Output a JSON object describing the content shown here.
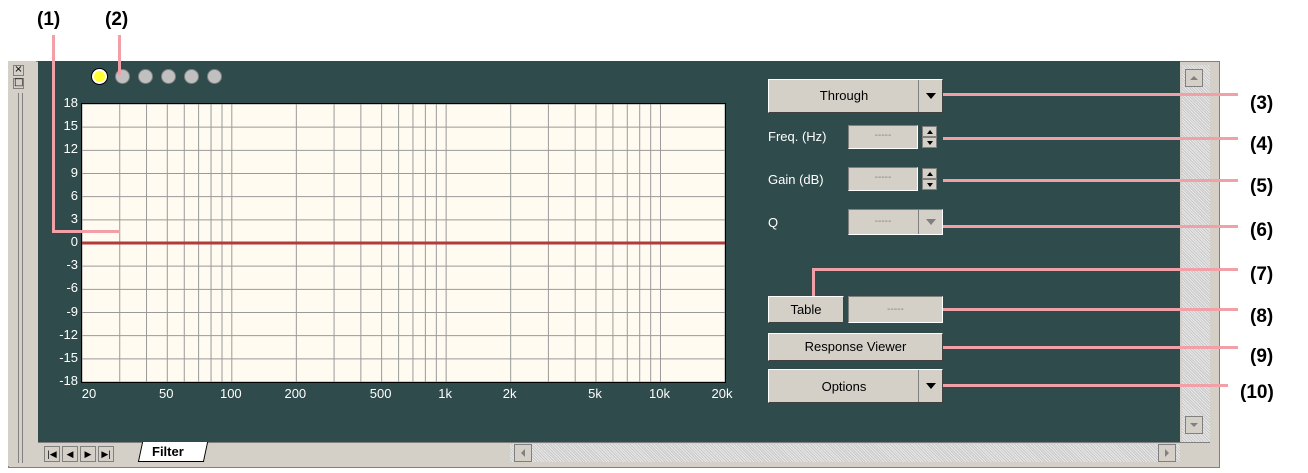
{
  "callouts": [
    "(1)",
    "(2)",
    "(3)",
    "(4)",
    "(5)",
    "(6)",
    "(7)",
    "(8)",
    "(9)",
    "(10)"
  ],
  "chart_data": {
    "type": "line",
    "x_ticks": [
      "20",
      "50",
      "100",
      "200",
      "500",
      "1k",
      "2k",
      "5k",
      "10k",
      "20k"
    ],
    "x_tick_values": [
      20,
      50,
      100,
      200,
      500,
      1000,
      2000,
      5000,
      10000,
      20000
    ],
    "xlim": [
      20,
      20000
    ],
    "x_scale": "log",
    "y_ticks": [
      "18",
      "15",
      "12",
      "9",
      "6",
      "3",
      "0",
      "-3",
      "-6",
      "-9",
      "-12",
      "-15",
      "-18"
    ],
    "ylim": [
      -18,
      18
    ],
    "grid": true,
    "series": [
      {
        "x": [
          20,
          20000
        ],
        "y": [
          0,
          0
        ],
        "color": "#b33a3a"
      }
    ]
  },
  "presets": {
    "count": 6,
    "active_index": 0
  },
  "controls": {
    "filter_type": "Through",
    "freq_label": "Freq. (Hz)",
    "freq_value": "-----",
    "gain_label": "Gain (dB)",
    "gain_value": "-----",
    "q_label": "Q",
    "q_value": "-----",
    "table_label": "Table",
    "table_value": "-----",
    "response_viewer_label": "Response Viewer",
    "options_label": "Options"
  },
  "tabs": {
    "sheet_label": "Filter"
  },
  "colors": {
    "panel_bg": "#2f4b4b",
    "plot_bg": "#fffbf0",
    "curve": "#b33a3a",
    "leader": "#f2a0a8",
    "active_preset": "#ffff33"
  }
}
